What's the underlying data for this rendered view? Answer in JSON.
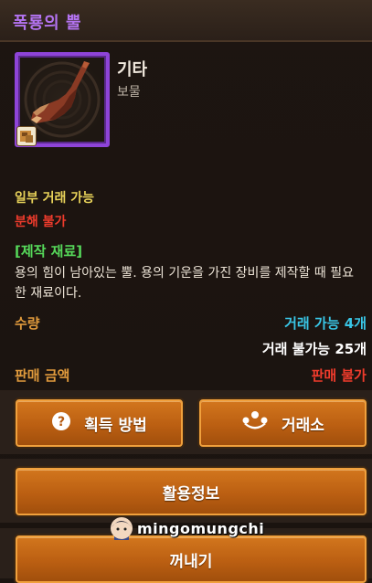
{
  "window": {
    "title": "폭룡의 뿔"
  },
  "item": {
    "category": "기타",
    "subcategory": "보물",
    "trade_status": "일부 거래 가능",
    "disassemble_status": "분해 불가",
    "material_header": "[제작 재료]",
    "description": "용의 힘이 남아있는 뿔. 용의 기운을 가진 장비를 제작할 때 필요한 재료이다.",
    "icon": "dragon-horn-icon",
    "badge_icon": "account-bound-icon"
  },
  "quantity": {
    "label": "수량",
    "tradable": "거래 가능 4개",
    "untradable": "거래 불가능 25개"
  },
  "price": {
    "label": "판매 금액",
    "value": "판매 불가"
  },
  "buttons": {
    "acquire": {
      "label": "획득 방법",
      "icon": "question-icon"
    },
    "exchange": {
      "label": "거래소",
      "icon": "exchange-icon"
    },
    "usage": {
      "label": "활용정보"
    },
    "take_out": {
      "label": "꺼내기"
    }
  },
  "watermark": {
    "text": "mingomungchi"
  },
  "colors": {
    "title": "#b373f0",
    "frame": "#8e44d8",
    "trade": "#e9d35a",
    "disassemble": "#ee3b2c",
    "material": "#56d95a",
    "label": "#e09a3c",
    "tradable": "#39c6e6",
    "button": "#c86a18"
  }
}
